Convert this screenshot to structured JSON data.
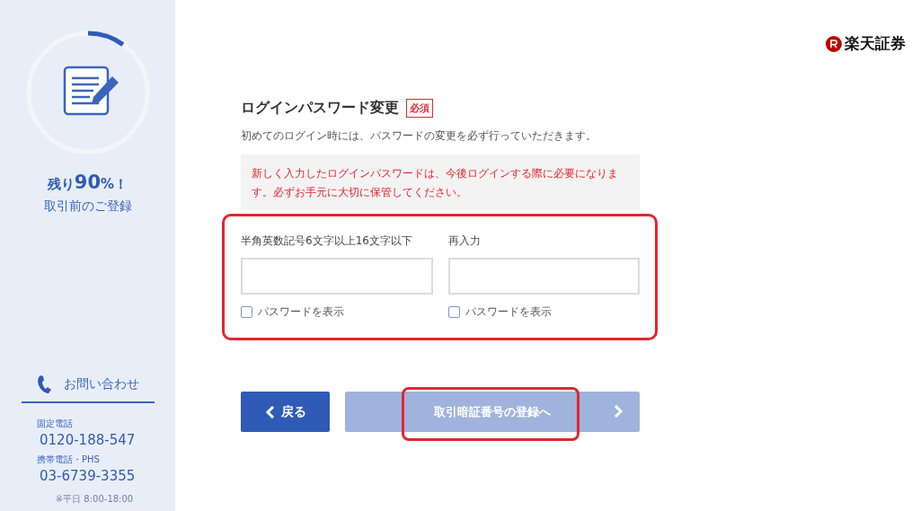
{
  "sidebar": {
    "progress": {
      "level": 0.1,
      "remaining_prefix": "残り",
      "remaining_number": "90",
      "remaining_suffix": "%！",
      "caption": "取引前のご登録"
    },
    "contact": {
      "title": "お問い合わせ",
      "lines": [
        {
          "label": "固定電話",
          "number": "0120-188-547"
        },
        {
          "label": "携帯電話・PHS",
          "number": "03-6739-3355"
        }
      ],
      "hours": "※平日 8:00-18:00"
    }
  },
  "logo": {
    "text": "楽天証券"
  },
  "form": {
    "title": "ログインパスワード変更",
    "required_badge": "必須",
    "description": "初めてのログイン時には、パスワードの変更を必ず行っていただきます。",
    "notice": "新しく入力したログインパスワードは、今後ログインする際に必要になります。必ずお手元に大切に保管してください。",
    "fields": [
      {
        "label": "半角英数記号6文字以上16文字以下",
        "show_password": {
          "label": "パスワードを表示",
          "checked": false
        }
      },
      {
        "label": "再入力",
        "show_password": {
          "label": "パスワードを表示",
          "checked": false
        }
      }
    ],
    "back_button": {
      "label": "戻る"
    },
    "next_button": {
      "label": "取引暗証番号の登録へ",
      "disabled": true
    }
  }
}
